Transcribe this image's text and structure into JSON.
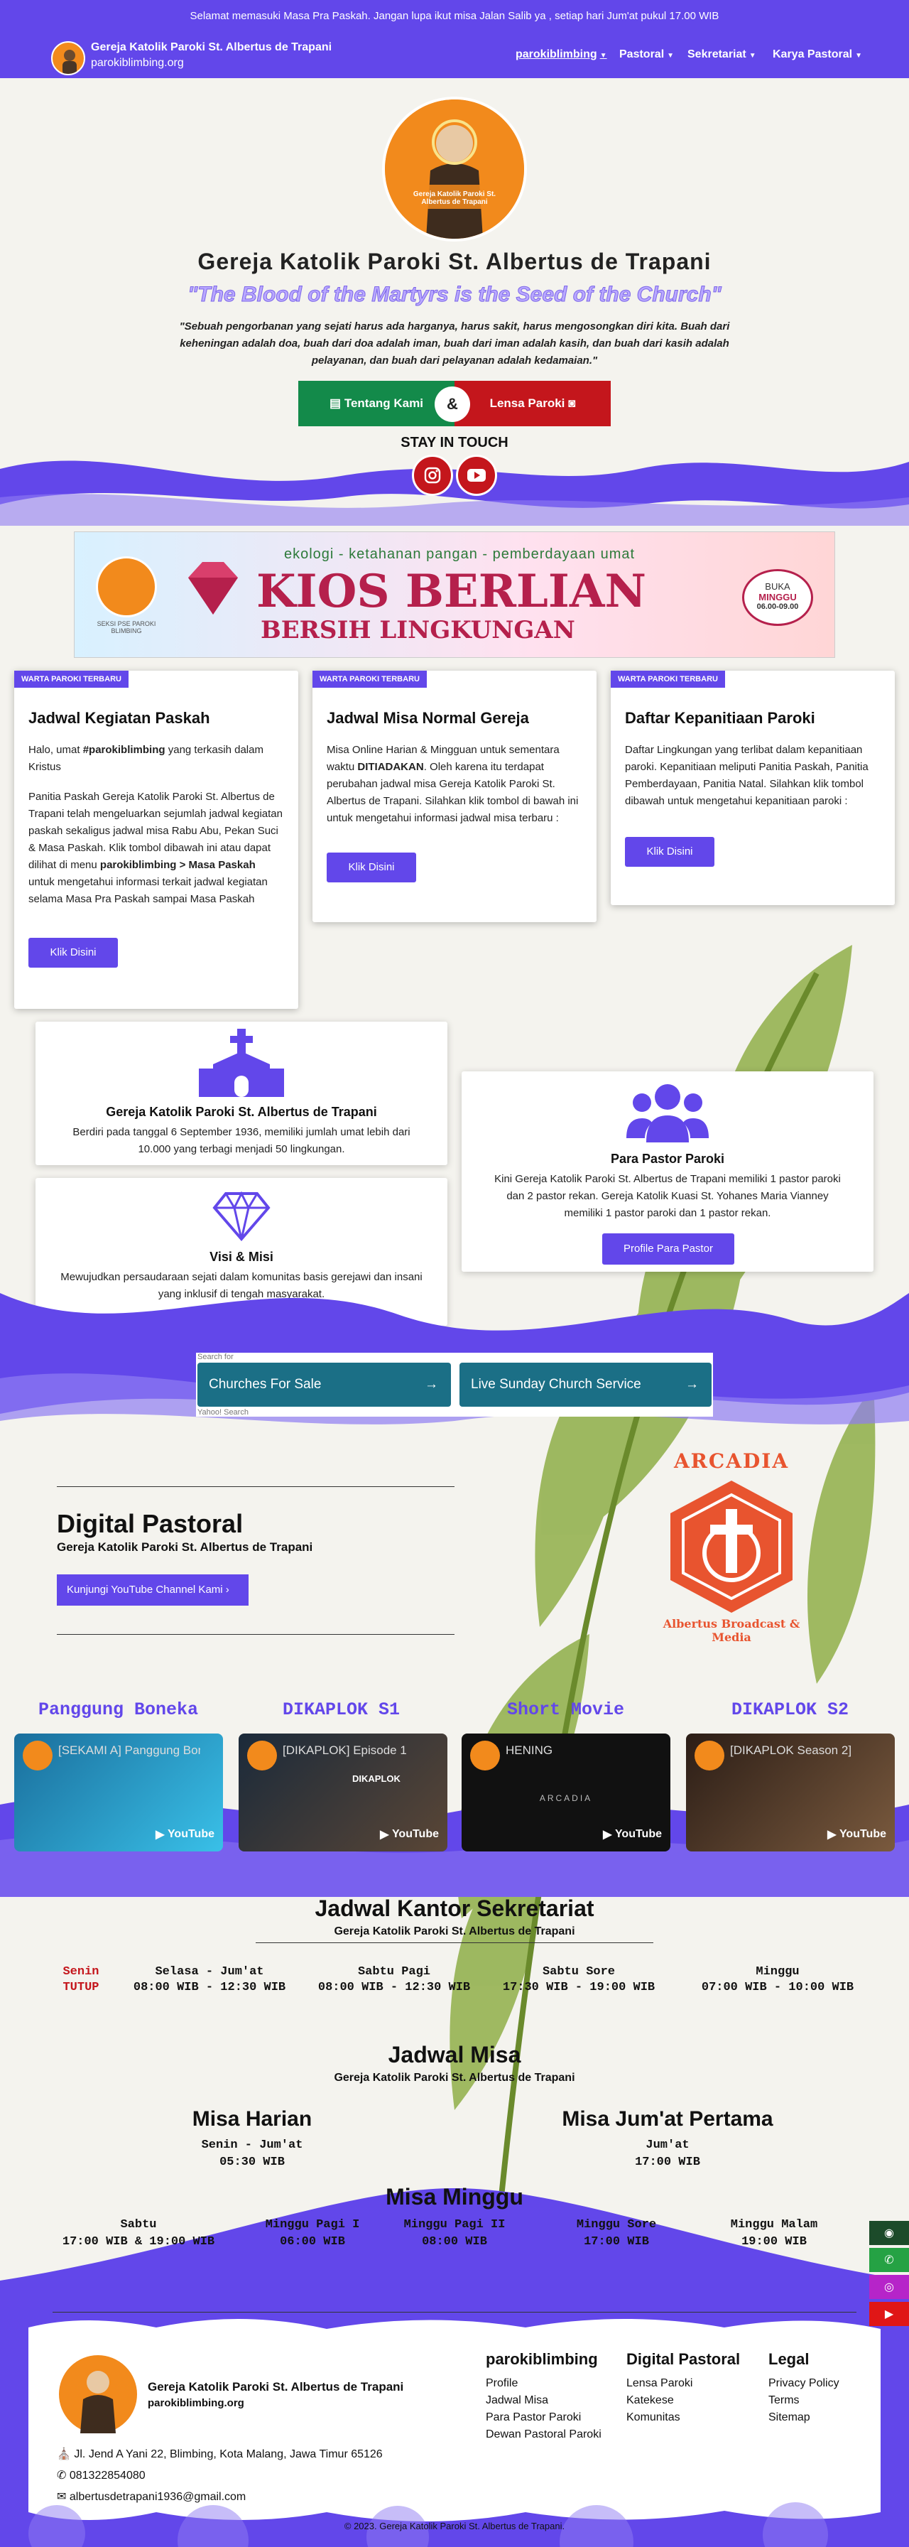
{
  "topbar": {
    "text": "Selamat memasuki Masa Pra Paskah. Jangan lupa ikut misa Jalan Salib ya , setiap hari Jum'at pukul 17.00 WIB"
  },
  "brand": {
    "name": "Gereja Katolik Paroki St. Albertus de Trapani",
    "url": "parokiblimbing.org"
  },
  "nav": [
    {
      "label": "parokiblimbing"
    },
    {
      "label": "Pastoral"
    },
    {
      "label": "Sekretariat"
    },
    {
      "label": "Karya Pastoral"
    }
  ],
  "hero": {
    "title": "Gereja Katolik Paroki St. Albertus de Trapani",
    "motto": "\"The Blood of the Martyrs is the Seed of the Church\"",
    "quote": "\"Sebuah pengorbanan yang sejati harus ada harganya, harus sakit, harus mengosongkan diri kita. Buah dari keheningan adalah doa, buah dari doa adalah iman, buah dari iman adalah kasih, dan buah dari kasih adalah pelayanan, dan buah dari pelayanan adalah kedamaian.\"",
    "btn_about": "Tentang Kami",
    "btn_and": "&",
    "btn_lensa": "Lensa Paroki",
    "stay": "STAY IN TOUCH",
    "logo_text": "Gereja Katolik Paroki St. Albertus de Trapani"
  },
  "banner": {
    "line1": "ekologi - ketahanan pangan - pemberdayaan umat",
    "line2": "KIOS BERLIAN",
    "line3": "BERSIH LINGKUNGAN",
    "badge1": "BUKA",
    "badge2": "MINGGU",
    "badge3": "06.00-09.00",
    "logo_caption": "SEKSI PSE PAROKI BLIMBING"
  },
  "cards": [
    {
      "tag": "WARTA PAROKI TERBARU",
      "title": "Jadwal Kegiatan Paskah",
      "p1a": "Halo, umat ",
      "p1b": "#parokiblimbing",
      "p1c": " yang terkasih dalam Kristus",
      "p2a": "Panitia Paskah Gereja Katolik Paroki St. Albertus de Trapani telah mengeluarkan sejumlah jadwal kegiatan paskah sekaligus jadwal misa Rabu Abu, Pekan Suci & Masa Paskah. Klik tombol dibawah ini atau dapat dilihat di menu ",
      "p2b": "parokiblimbing > Masa Paskah",
      "p2c": " untuk mengetahui informasi terkait jadwal kegiatan selama Masa Pra Paskah sampai Masa Paskah",
      "btn": "Klik Disini"
    },
    {
      "tag": "WARTA PAROKI TERBARU",
      "title": "Jadwal Misa Normal Gereja",
      "p1a": "Misa Online Harian & Mingguan untuk sementara waktu ",
      "p1b": "DITIADAKAN",
      "p1c": ". Oleh karena itu terdapat perubahan jadwal misa Gereja Katolik Paroki St. Albertus de Trapani. Silahkan klik tombol di bawah ini untuk mengetahui informasi jadwal misa terbaru :",
      "btn": "Klik Disini"
    },
    {
      "tag": "WARTA PAROKI TERBARU",
      "title": "Daftar Kepanitiaan Paroki",
      "p1": "Daftar Lingkungan yang terlibat dalam kepanitiaan paroki. Kepanitiaan meliputi Panitia Paskah, Panitia Pemberdayaan, Panitia Natal. Silahkan klik tombol dibawah untuk mengetahui kepanitiaan paroki :",
      "btn": "Klik Disini"
    }
  ],
  "features": {
    "church": {
      "title": "Gereja Katolik Paroki St. Albertus de Trapani",
      "text": "Berdiri pada tanggal 6 September 1936, memiliki jumlah umat lebih dari 10.000 yang terbagi menjadi 50 lingkungan."
    },
    "vision": {
      "title": "Visi & Misi",
      "text": "Mewujudkan persaudaraan sejati dalam komunitas basis gerejawi dan insani yang inklusif di tengah masyarakat."
    },
    "pastor": {
      "title": "Para Pastor Paroki",
      "text": "Kini Gereja Katolik Paroki St. Albertus de Trapani memiliki 1 pastor paroki dan 2 pastor rekan. Gereja Katolik Kuasi St. Yohanes Maria Vianney memiliki 1 pastor paroki dan 1 pastor rekan.",
      "btn": "Profile Para Pastor"
    }
  },
  "ad": {
    "search_for": "Search for",
    "link1": "Churches For Sale",
    "link2": "Live Sunday Church Service",
    "provider": "Yahoo! Search"
  },
  "digital": {
    "title": "Digital Pastoral",
    "subtitle": "Gereja Katolik Paroki St. Albertus de Trapani",
    "btn": "Kunjungi YouTube Channel Kami",
    "logo_top": "ARCADIA",
    "logo_bottom": "Albertus Broadcast & Media"
  },
  "videos": [
    {
      "label": "Panggung Boneka",
      "title": "[SEKAMI A] Panggung Boneka",
      "thumb_text": "",
      "brand": "YouTube"
    },
    {
      "label": "DIKAPLOK S1",
      "title": "[DIKAPLOK] Episode 1",
      "thumb_text": "DIKAPLOK",
      "brand": "YouTube"
    },
    {
      "label": "Short Movie",
      "title": "HENING",
      "thumb_text": "ARCADIA",
      "brand": "YouTube"
    },
    {
      "label": "DIKAPLOK S2",
      "title": "[DIKAPLOK Season 2]",
      "thumb_text": "",
      "brand": "YouTube"
    }
  ],
  "office": {
    "title": "Jadwal Kantor Sekretariat",
    "subtitle": "Gereja Katolik Paroki St. Albertus de Trapani",
    "closed": {
      "day": "Senin",
      "status": "TUTUP"
    },
    "slots": [
      {
        "day": "Selasa - Jum'at",
        "time": "08:00 WIB - 12:30 WIB"
      },
      {
        "day": "Sabtu Pagi",
        "time": "08:00 WIB - 12:30 WIB"
      },
      {
        "day": "Sabtu Sore",
        "time": "17:30 WIB - 19:00 WIB"
      },
      {
        "day": "Minggu",
        "time": "07:00 WIB - 10:00 WIB"
      }
    ]
  },
  "mass": {
    "title": "Jadwal Misa",
    "subtitle": "Gereja Katolik Paroki St. Albertus de Trapani",
    "daily": {
      "title": "Misa Harian",
      "day": "Senin - Jum'at",
      "time": "05:30 WIB"
    },
    "friday": {
      "title": "Misa Jum'at Pertama",
      "day": "Jum'at",
      "time": "17:00 WIB"
    },
    "sunday_title": "Misa Minggu",
    "sunday": [
      {
        "day": "Sabtu",
        "time": "17:00 WIB & 19:00 WIB"
      },
      {
        "day": "Minggu Pagi I",
        "time": "06:00 WIB"
      },
      {
        "day": "Minggu Pagi II",
        "time": "08:00 WIB"
      },
      {
        "day": "Minggu Sore",
        "time": "17:00 WIB"
      },
      {
        "day": "Minggu Malam",
        "time": "19:00 WIB"
      }
    ]
  },
  "footer": {
    "name": "Gereja Katolik Paroki St. Albertus de Trapani",
    "url": "parokiblimbing.org",
    "address": "Jl. Jend A Yani 22, Blimbing, Kota Malang, Jawa Timur 65126",
    "phone": "081322854080",
    "email": "albertusdetrapani1936@gmail.com",
    "col1": {
      "title": "parokiblimbing",
      "links": [
        "Profile",
        "Jadwal Misa",
        "Para Pastor Paroki",
        "Dewan Pastoral Paroki"
      ]
    },
    "col2": {
      "title": "Digital Pastoral",
      "links": [
        "Lensa Paroki",
        "Katekese",
        "Komunitas"
      ]
    },
    "col3": {
      "title": "Legal",
      "links": [
        "Privacy Policy",
        "Terms",
        "Sitemap"
      ]
    },
    "copyright": "© 2023. Gereja Katolik Paroki St. Albertus de Trapani."
  },
  "colors": {
    "primary": "#6247ea",
    "green": "#138a4a",
    "red": "#c4161c",
    "orange": "#f28a1c"
  }
}
